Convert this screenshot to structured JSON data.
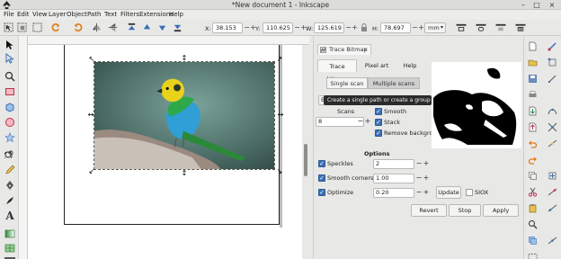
{
  "window": {
    "title": "*New document 1 - Inkscape",
    "minimize": "–",
    "maximize": "□",
    "close": "×"
  },
  "menu": [
    "File",
    "Edit",
    "View",
    "Layer",
    "Object",
    "Path",
    "Text",
    "Filters",
    "Extensions",
    "Help"
  ],
  "toolbar": {
    "x_label": "X:",
    "x_value": "38.153",
    "y_label": "Y:",
    "y_value": "110.625",
    "w_label": "W:",
    "w_value": "125.619",
    "h_label": "H:",
    "h_value": "78.697",
    "unit": "mm",
    "spin_minus": "−",
    "spin_plus": "+"
  },
  "dialog": {
    "tab_label": "Trace Bitmap",
    "tab_close": "×",
    "subtabs": [
      "Trace bitmap",
      "Pixel art",
      "Help"
    ],
    "scan_single": "Single scan",
    "scan_multiple": "Multiple scans",
    "tooltip": "Create a single path or create a group of paths",
    "combo_behind": "B",
    "scans_label": "Scans",
    "scans_value": "8",
    "smooth_label": "Smooth",
    "stack_label": "Stack",
    "remove_bg_label": "Remove background",
    "options_heading": "Options",
    "speckles_label": "Speckles",
    "speckles_value": "2",
    "smooth_corners_label": "Smooth corners",
    "smooth_corners_value": "1.00",
    "optimize_label": "Optimize",
    "optimize_value": "0.20",
    "update_button": "Update",
    "siox_label": "SIOX",
    "revert_button": "Revert",
    "stop_button": "Stop",
    "apply_button": "Apply",
    "minus": "−",
    "plus": "+",
    "checkmark": "✓"
  },
  "canvas": {
    "handle_glyph_corner": "↖",
    "handle_glyph_edge": "↔"
  },
  "colors": {
    "accent": "#3b6fb6",
    "tooltip_bg": "#2b2b2b"
  }
}
